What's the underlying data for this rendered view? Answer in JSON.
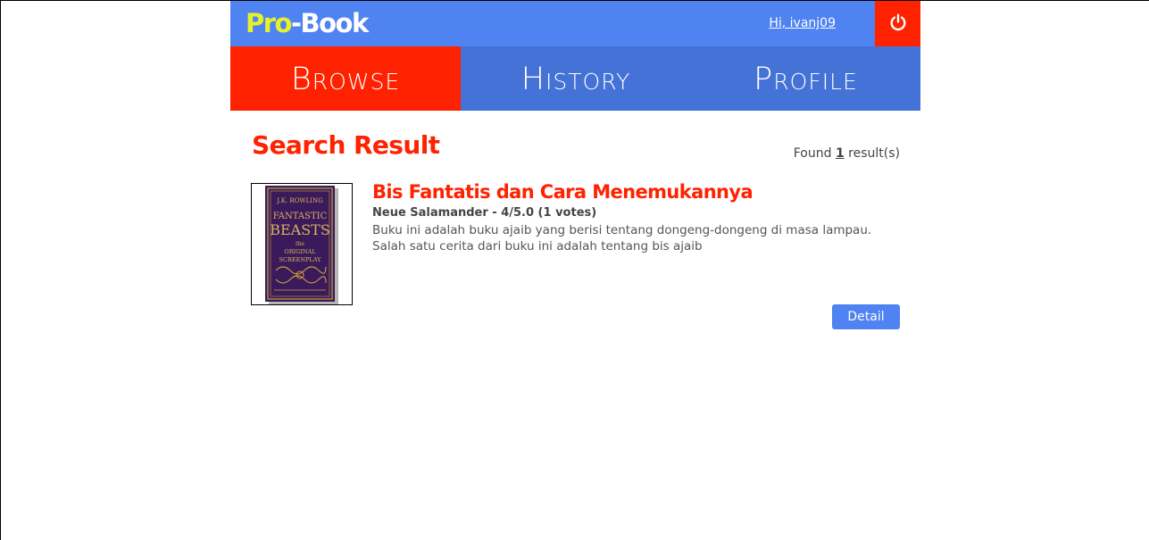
{
  "header": {
    "logo_prefix": "Pro",
    "logo_suffix": "-Book",
    "greeting": "Hi, ivanj09",
    "logout_icon": "power-icon",
    "colors": {
      "topbar": "#4f83f1",
      "logout": "#ff2200",
      "logo_accent": "#e8f02a"
    }
  },
  "nav": {
    "tabs": [
      {
        "label": "Browse",
        "active": true
      },
      {
        "label": "History",
        "active": false
      },
      {
        "label": "Profile",
        "active": false
      }
    ],
    "colors": {
      "active": "#ff2200",
      "inactive": "#4472d6"
    }
  },
  "results": {
    "title": "Search Result",
    "found_prefix": "Found",
    "found_count": "1",
    "found_suffix": "result(s)",
    "items": [
      {
        "title": "Bis Fantatis dan Cara Menemukannya",
        "meta": "Neue Salamander - 4/5.0 (1 votes)",
        "description": "Buku ini adalah buku ajaib yang berisi tentang dongeng-dongeng di masa lampau. Salah satu cerita dari buku ini adalah tentang bis ajaib",
        "cover_author": "J.K. ROWLING",
        "cover_title_1": "FANTASTIC",
        "cover_title_2": "BEASTS",
        "cover_subtitle_1": "the",
        "cover_subtitle_2": "ORIGINAL",
        "cover_subtitle_3": "SCREENPLAY",
        "detail_label": "Detail"
      }
    ],
    "colors": {
      "accent": "#ff2200",
      "button": "#4f83f1"
    }
  }
}
